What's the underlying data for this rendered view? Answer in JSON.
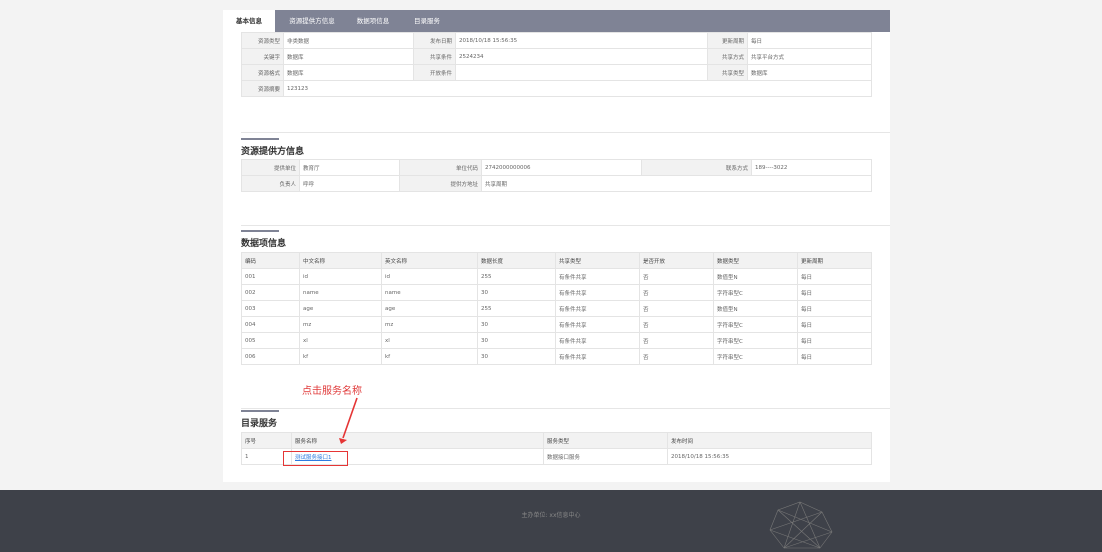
{
  "tabs": [
    "基本信息",
    "资源提供方信息",
    "数据项信息",
    "目录服务"
  ],
  "basic": {
    "rows": [
      [
        "资源类型",
        "非类数据",
        "发布日期",
        "2018/10/18 15:56:35",
        "更新周期",
        "每日"
      ],
      [
        "关键字",
        "数据库",
        "共享条件",
        "2524234",
        "共享方式",
        "共享平台方式"
      ],
      [
        "资源格式",
        "数据库",
        "开放条件",
        "",
        "共享类型",
        "数据库"
      ],
      [
        "资源摘要",
        "123123",
        "",
        "",
        "",
        ""
      ]
    ]
  },
  "provider": {
    "title": "资源提供方信息",
    "rows": [
      [
        "提供单位",
        "教育厅",
        "单位代码",
        "2742000000006",
        "联系方式",
        "189----3022"
      ],
      [
        "负责人",
        "呼呼",
        "提供方地址",
        "共享周期",
        "",
        ""
      ]
    ]
  },
  "dataitems": {
    "title": "数据项信息",
    "headers": [
      "编码",
      "中文名称",
      "英文名称",
      "数据长度",
      "共享类型",
      "是否开放",
      "数据类型",
      "更新周期"
    ],
    "rows": [
      [
        "001",
        "id",
        "id",
        "255",
        "有条件共享",
        "否",
        "数值型N",
        "每日"
      ],
      [
        "002",
        "name",
        "name",
        "30",
        "有条件共享",
        "否",
        "字符串型C",
        "每日"
      ],
      [
        "003",
        "age",
        "age",
        "255",
        "有条件共享",
        "否",
        "数值型N",
        "每日"
      ],
      [
        "004",
        "mz",
        "mz",
        "30",
        "有条件共享",
        "否",
        "字符串型C",
        "每日"
      ],
      [
        "005",
        "xl",
        "xl",
        "30",
        "有条件共享",
        "否",
        "字符串型C",
        "每日"
      ],
      [
        "006",
        "kf",
        "kf",
        "30",
        "有条件共享",
        "否",
        "字符串型C",
        "每日"
      ]
    ]
  },
  "service": {
    "title": "目录服务",
    "headers": [
      "序号",
      "服务名称",
      "服务类型",
      "发布时间"
    ],
    "rows": [
      [
        "1",
        "测试服务接口1",
        "数据接口服务",
        "2018/10/18 15:56:35"
      ]
    ]
  },
  "annotation": "点击服务名称",
  "footer": "主办单位: xx信息中心",
  "colors": {
    "tabbar": "#7f8395",
    "footer": "#3e4149",
    "annotation": "#e03a3a",
    "link": "#2d7be0"
  }
}
